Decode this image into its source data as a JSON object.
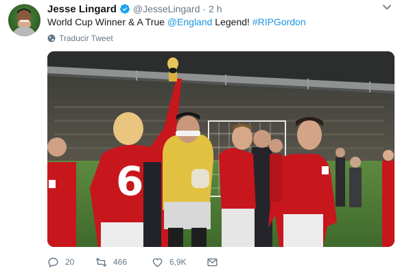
{
  "tweet": {
    "author_name": "Jesse Lingard",
    "handle": "@JesseLingard",
    "separator": "·",
    "time": "2 h",
    "text": {
      "part1": "World Cup Winner & A True ",
      "mention": "@England",
      "part2": " Legend! ",
      "hashtag": "#RIPGordon"
    },
    "translate_label": "Traducir Tweet",
    "photo": {
      "shirt_number": "6"
    },
    "actions": {
      "replies": "20",
      "retweets": "466",
      "likes": "6,9K"
    }
  },
  "icons": {
    "verified": "verified-badge-icon",
    "caret": "chevron-down-icon",
    "globe": "globe-icon",
    "reply": "reply-icon",
    "retweet": "retweet-icon",
    "like": "heart-icon",
    "dm": "envelope-icon"
  },
  "colors": {
    "link": "#1b95e0",
    "verified": "#1da1f2",
    "secondary_text": "#657786",
    "shirt_red": "#c8161d",
    "goalkeeper_yellow": "#e1c13f"
  }
}
